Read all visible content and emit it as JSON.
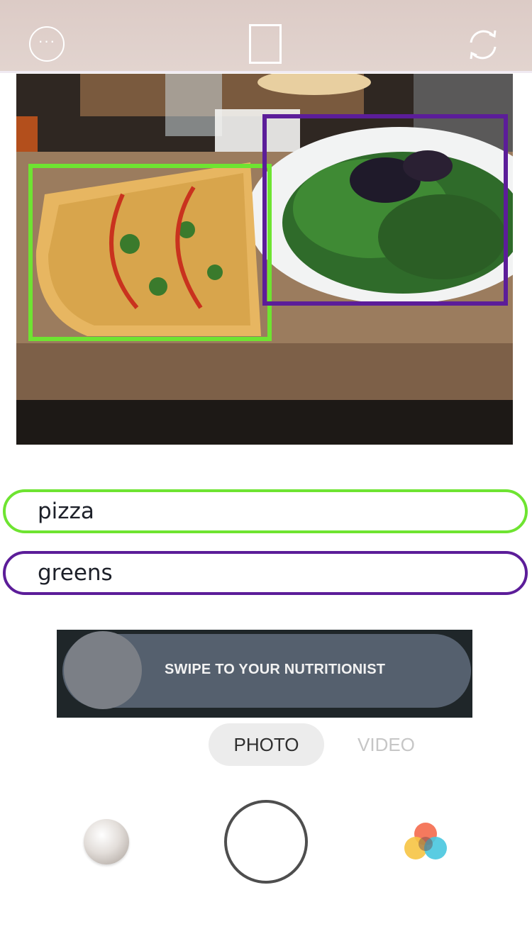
{
  "top_bar": {
    "more_icon": "ellipsis-circle-icon",
    "frame_icon": "portrait-frame-icon",
    "flip_icon": "camera-flip-icon"
  },
  "photo": {
    "description_icon": "food-photo",
    "detections": [
      {
        "label": "pizza",
        "color": "#6ee431"
      },
      {
        "label": "greens",
        "color": "#5c1d99"
      }
    ]
  },
  "tags": {
    "pizza": "pizza",
    "greens": "greens"
  },
  "swipe": {
    "label": "SWIPE TO YOUR NUTRITIONIST"
  },
  "modes": {
    "photo": "PHOTO",
    "video": "VIDEO",
    "selected": "PHOTO"
  },
  "bottom_controls": {
    "gallery_icon": "gallery-thumbnail-icon",
    "shutter_icon": "shutter-button-icon",
    "filters_icon": "color-filters-icon"
  }
}
